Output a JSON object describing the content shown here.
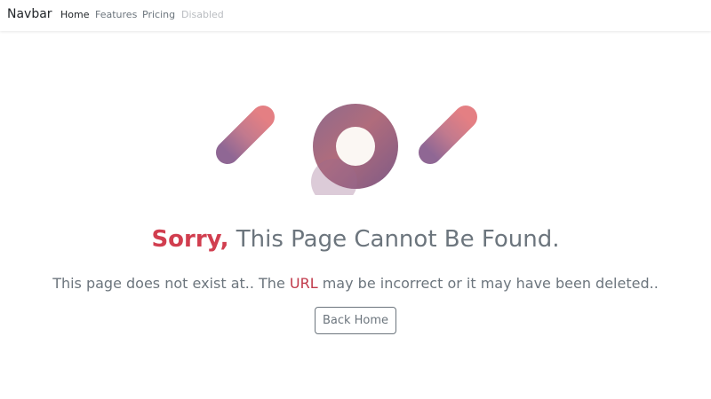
{
  "navbar": {
    "brand": "Navbar",
    "links": [
      {
        "label": "Home",
        "state": "active"
      },
      {
        "label": "Features",
        "state": "normal"
      },
      {
        "label": "Pricing",
        "state": "normal"
      },
      {
        "label": "Disabled",
        "state": "disabled"
      }
    ]
  },
  "hero": {
    "digits": "404",
    "headline_accent": "Sorry,",
    "headline_rest": " This Page Cannot Be Found.",
    "sub_before": "This page does not exist at.. The ",
    "sub_accent": "URL",
    "sub_after": " may be incorrect or it may have been deleted..",
    "button_label": "Back Home"
  },
  "colors": {
    "accent": "#d13e4f",
    "muted_text": "#6c757d",
    "gradient_pink": "#e8777c",
    "gradient_purple": "#8a6592"
  }
}
